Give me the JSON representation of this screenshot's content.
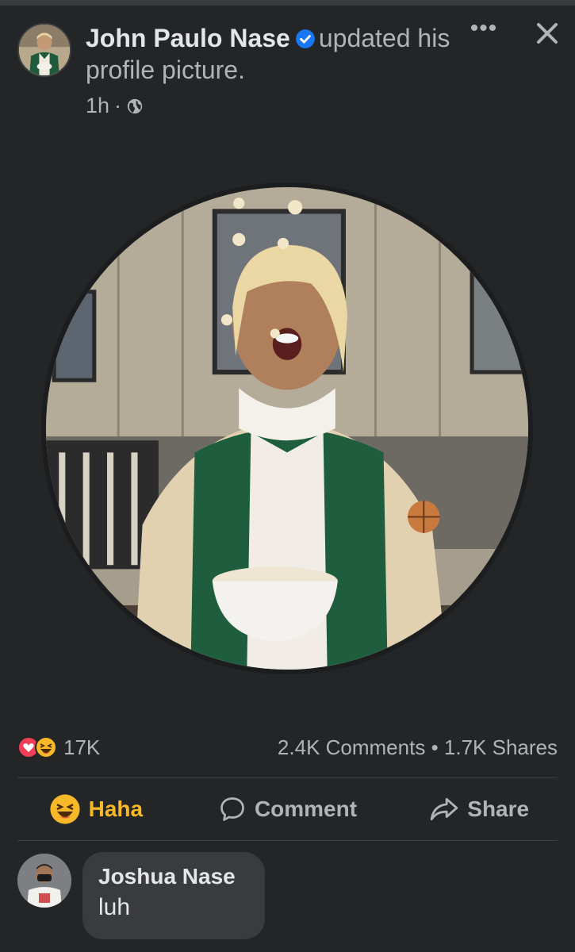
{
  "post": {
    "author": "John Paulo Nase",
    "update_text": "updated his profile picture.",
    "time": "1h",
    "time_separator": "·",
    "privacy_icon": "globe-icon",
    "more_icon": "ellipsis-icon",
    "more_label": "•••",
    "close_icon": "close-icon"
  },
  "stats": {
    "reaction_icons": [
      "love-icon",
      "haha-icon"
    ],
    "reaction_count": "17K",
    "comments": "2.4K Comments",
    "separator": "•",
    "shares": "1.7K Shares"
  },
  "actions": {
    "haha": "Haha",
    "comment": "Comment",
    "share": "Share"
  },
  "comment": {
    "author": "Joshua Nase",
    "text": "luh"
  },
  "colors": {
    "background": "#242526",
    "text_primary": "#e4e6eb",
    "text_secondary": "#b0b3b8",
    "verified_blue": "#1877f2",
    "haha_yellow": "#f7b928",
    "love_red": "#f33e58",
    "bubble": "#3a3b3c"
  }
}
